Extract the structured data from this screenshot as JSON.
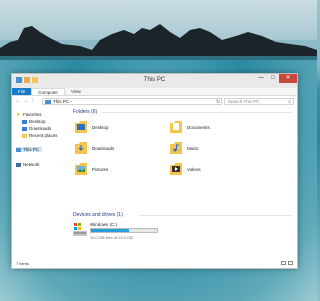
{
  "window": {
    "title": "This PC",
    "controls": {
      "minimize": "—",
      "maximize": "□",
      "close": "✕"
    }
  },
  "ribbon": {
    "tabs": [
      {
        "label": "File"
      },
      {
        "label": "Computer"
      },
      {
        "label": "View"
      }
    ]
  },
  "address": {
    "path": "This PC",
    "separator": "›",
    "search_placeholder": "Search This PC"
  },
  "sidebar": {
    "favorites": "Favorites",
    "items": [
      {
        "label": "Desktop"
      },
      {
        "label": "Downloads"
      },
      {
        "label": "Recent places"
      }
    ],
    "this_pc": "This PC",
    "network": "Network"
  },
  "main": {
    "folders_header": "Folders (6)",
    "folders": [
      {
        "label": "Desktop"
      },
      {
        "label": "Documents"
      },
      {
        "label": "Downloads"
      },
      {
        "label": "Music"
      },
      {
        "label": "Pictures"
      },
      {
        "label": "Videos"
      }
    ],
    "devices_header": "Devices and drives (1)",
    "drive": {
      "name": "Windows (C:)",
      "free_text": "10.0 GB free of 23.0 GB",
      "used_fraction": 0.57
    }
  },
  "status": {
    "items": "7 items"
  },
  "colors": {
    "accent": "#1979ca",
    "close": "#c9463d",
    "drive_bar": "#26a0da",
    "section_header": "#1e3c78"
  }
}
